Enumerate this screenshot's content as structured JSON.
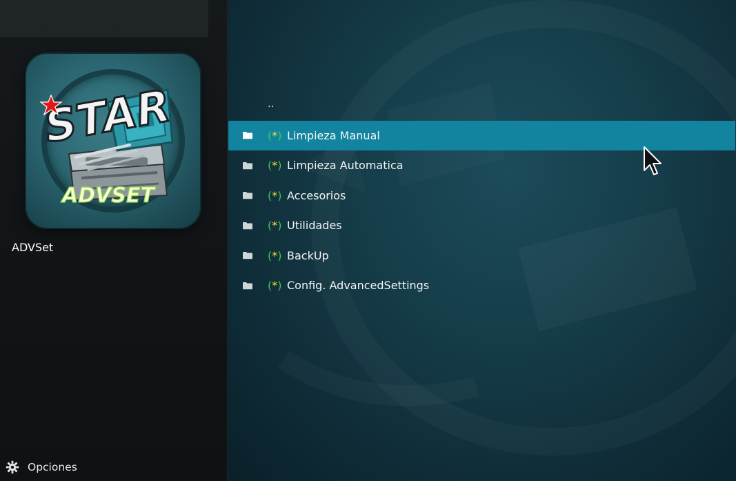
{
  "addon": {
    "name": "ADVSet",
    "thumbnail": {
      "logo_text": "STAR",
      "subtitle_text": "ADVSET"
    }
  },
  "footer": {
    "options_label": "Opciones",
    "options_icon": "gear-icon"
  },
  "list": {
    "parent_label": "..",
    "items": [
      {
        "prefix_open": "(",
        "prefix_star": "*",
        "prefix_close": ")",
        "label": "Limpieza Manual",
        "icon": "folder-icon",
        "selected": true
      },
      {
        "prefix_open": "(",
        "prefix_star": "*",
        "prefix_close": ")",
        "label": "Limpieza Automatica",
        "icon": "folder-icon",
        "selected": false
      },
      {
        "prefix_open": "(",
        "prefix_star": "*",
        "prefix_close": ")",
        "label": "Accesorios",
        "icon": "folder-icon",
        "selected": false
      },
      {
        "prefix_open": "(",
        "prefix_star": "*",
        "prefix_close": ")",
        "label": "Utilidades",
        "icon": "folder-icon",
        "selected": false
      },
      {
        "prefix_open": "(",
        "prefix_star": "*",
        "prefix_close": ")",
        "label": "BackUp",
        "icon": "folder-icon",
        "selected": false
      },
      {
        "prefix_open": "(",
        "prefix_star": "*",
        "prefix_close": ")",
        "label": "Config. AdvancedSettings",
        "icon": "folder-icon",
        "selected": false
      }
    ]
  },
  "colors": {
    "selection": "#12849f",
    "prefix_paren": "#45c44a",
    "prefix_star": "#ffe233",
    "left_bg": "#131719",
    "right_bg": "#163e4b"
  }
}
